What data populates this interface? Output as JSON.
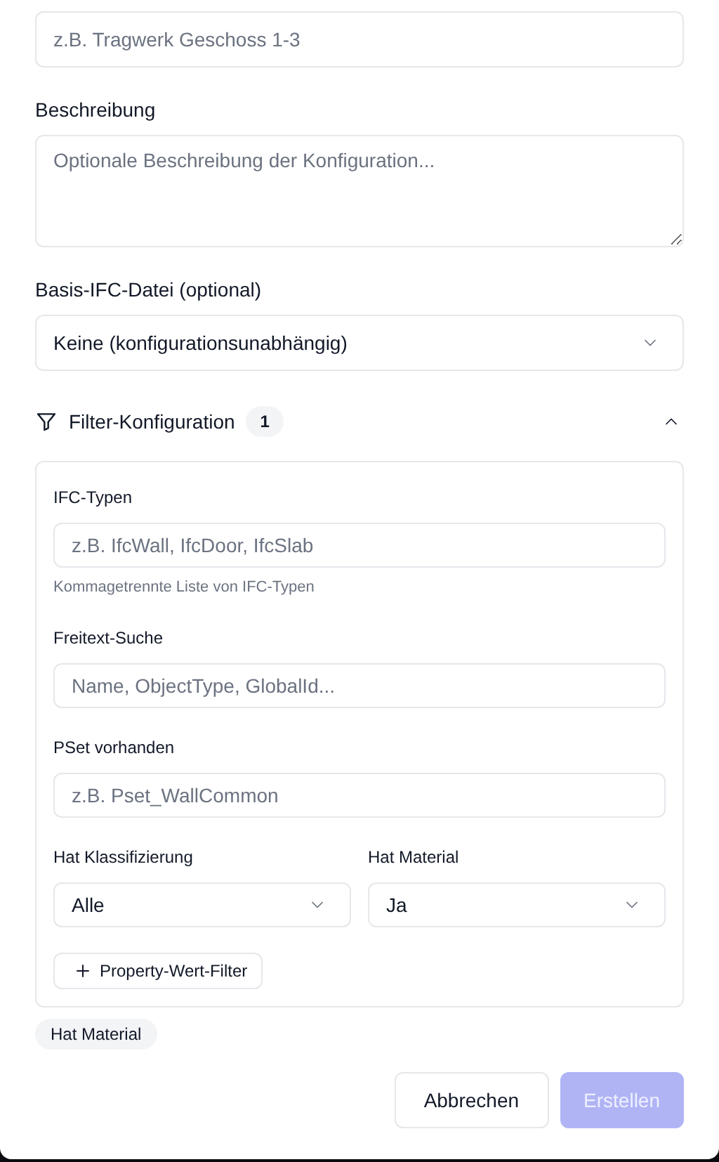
{
  "name_field": {
    "placeholder": "z.B. Tragwerk Geschoss 1-3"
  },
  "description": {
    "label": "Beschreibung",
    "placeholder": "Optionale Beschreibung der Konfiguration..."
  },
  "base_file": {
    "label": "Basis-IFC-Datei (optional)",
    "value": "Keine (konfigurationsunabhängig)"
  },
  "filter": {
    "title": "Filter-Konfiguration",
    "count": "1",
    "expanded": true,
    "fields": [
      {
        "label": "IFC-Typen",
        "placeholder": "z.B. IfcWall, IfcDoor, IfcSlab",
        "hint": "Kommagetrennte Liste von IFC-Typen"
      },
      {
        "label": "Freitext-Suche",
        "placeholder": "Name, ObjectType, GlobalId..."
      },
      {
        "label": "PSet vorhanden",
        "placeholder": "z.B. Pset_WallCommon"
      }
    ],
    "selects": [
      {
        "label": "Hat Klassifizierung",
        "value": "Alle"
      },
      {
        "label": "Hat Material",
        "value": "Ja"
      }
    ],
    "add_button": "Property-Wert-Filter"
  },
  "active_filters": [
    "Hat Material"
  ],
  "buttons": [
    {
      "label": "Abbrechen",
      "kind": "secondary",
      "disabled": false
    },
    {
      "label": "Erstellen",
      "kind": "primary",
      "disabled": true
    }
  ]
}
